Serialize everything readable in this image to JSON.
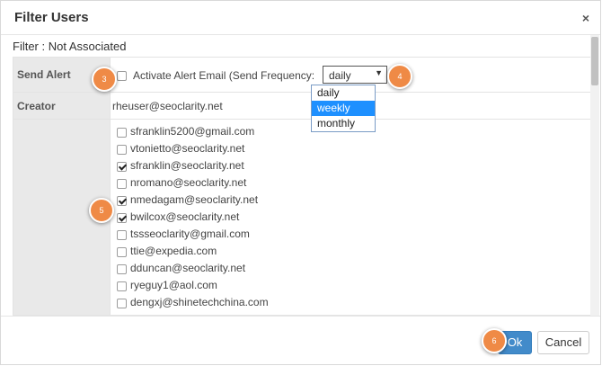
{
  "dialog": {
    "title": "Filter Users",
    "close": "×",
    "subtitle": "Filter : Not Associated"
  },
  "send_alert": {
    "label": "Send Alert",
    "checkbox_label": "Activate Alert Email (Send Frequency:",
    "checked": false,
    "frequency": {
      "value": "daily",
      "options": [
        "daily",
        "weekly",
        "monthly"
      ],
      "highlighted": "weekly"
    }
  },
  "creator": {
    "label": "Creator",
    "value": "rheuser@seoclarity.net"
  },
  "users": [
    {
      "email": "sfranklin5200@gmail.com",
      "checked": false
    },
    {
      "email": "vtonietto@seoclarity.net",
      "checked": false
    },
    {
      "email": "sfranklin@seoclarity.net",
      "checked": true
    },
    {
      "email": "nromano@seoclarity.net",
      "checked": false
    },
    {
      "email": "nmedagam@seoclarity.net",
      "checked": true
    },
    {
      "email": "bwilcox@seoclarity.net",
      "checked": true
    },
    {
      "email": "tssseoclarity@gmail.com",
      "checked": false
    },
    {
      "email": "ttie@expedia.com",
      "checked": false
    },
    {
      "email": "dduncan@seoclarity.net",
      "checked": false
    },
    {
      "email": "ryeguy1@aol.com",
      "checked": false
    },
    {
      "email": "dengxj@shinetechchina.com",
      "checked": false
    }
  ],
  "markers": [
    "3",
    "4",
    "5",
    "6"
  ],
  "footer": {
    "ok": "Ok",
    "cancel": "Cancel"
  },
  "colors": {
    "primary": "#428bca",
    "marker": "#ef8a46",
    "highlight": "#1e90ff"
  }
}
